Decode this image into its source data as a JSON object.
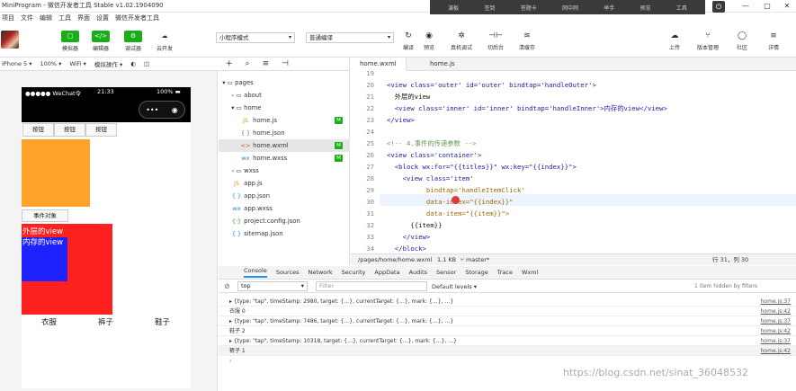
{
  "window": {
    "title": "MiniProgram - 微信开发者工具 Stable v1.02.1904090",
    "controls": [
      "—",
      "□",
      "✕"
    ]
  },
  "float_bar": [
    "演板",
    "签到",
    "答题卡",
    "网中网",
    "举手",
    "预览",
    "工具"
  ],
  "menu": [
    "项目",
    "文件",
    "编辑",
    "工具",
    "界面",
    "设置",
    "微信开发者工具"
  ],
  "toolbar": {
    "left": [
      {
        "icon": "▢",
        "label": "模拟器"
      },
      {
        "icon": "</>",
        "label": "编辑器"
      },
      {
        "icon": "⚙",
        "label": "调试器"
      },
      {
        "icon": "☁",
        "label": "云开发"
      }
    ],
    "mode_select": "小程序模式",
    "compile_select": "普通编译",
    "mid": [
      {
        "icon": "↻",
        "label": "编译"
      },
      {
        "icon": "◉",
        "label": "预览"
      },
      {
        "icon": "✲",
        "label": "真机调试"
      },
      {
        "icon": "⊣⊢",
        "label": "切后台"
      },
      {
        "icon": "≋",
        "label": "清缓存"
      }
    ],
    "right": [
      {
        "icon": "☁",
        "label": "上传"
      },
      {
        "icon": "⑂",
        "label": "版本管理"
      },
      {
        "icon": "◯",
        "label": "社区"
      },
      {
        "icon": "≡",
        "label": "详情"
      }
    ]
  },
  "sim_bar": [
    "iPhone 5 ▾",
    "100% ▾",
    "WiFi ▾",
    "模拟操作 ▾",
    "◐",
    "◫"
  ],
  "phone": {
    "carrier": "●●●●● WeChat令",
    "time": "21:33",
    "battery": "100% ▬",
    "capsule": [
      "•••",
      "◉"
    ],
    "buttons": [
      "按钮",
      "按钮",
      "按钮"
    ],
    "event_button": "事件对象",
    "outer_text": "外层的view",
    "inner_text": "内存的view",
    "items": [
      "衣服",
      "裤子",
      "鞋子"
    ]
  },
  "tree": {
    "head": [
      "+",
      "⌕",
      "≡",
      "⊣"
    ],
    "nodes": [
      {
        "icon": "▾ ▭",
        "label": "pages",
        "badge": ""
      },
      {
        "icon": "› ▭",
        "label": "about",
        "badge": ""
      },
      {
        "icon": "▾ ▭",
        "label": "home",
        "badge": ""
      },
      {
        "icon": "JS",
        "label": "home.js",
        "badge": "M"
      },
      {
        "icon": "{ }",
        "label": "home.json",
        "badge": ""
      },
      {
        "icon": "<>",
        "label": "home.wxml",
        "badge": "M"
      },
      {
        "icon": "wx",
        "label": "home.wxss",
        "badge": "M"
      },
      {
        "icon": "› ▭",
        "label": "wxss",
        "badge": ""
      },
      {
        "icon": "JS",
        "label": "app.js",
        "badge": ""
      },
      {
        "icon": "{ }",
        "label": "app.json",
        "badge": ""
      },
      {
        "icon": "wx",
        "label": "app.wxss",
        "badge": ""
      },
      {
        "icon": "{·}",
        "label": "project.config.json",
        "badge": ""
      },
      {
        "icon": "{ }",
        "label": "sitemap.json",
        "badge": ""
      }
    ]
  },
  "editor": {
    "tabs": [
      "home.wxml",
      "home.js"
    ],
    "line_numbers": [
      "19",
      "20",
      "21",
      "22",
      "23",
      "24",
      "25",
      "26",
      "27",
      "28",
      "29",
      "30",
      "31",
      "32",
      "33",
      "34"
    ],
    "lines": [
      "",
      "<view class='outer' id='outer' bindtap='handleOuter'>",
      "  外层的view",
      "  <view class='inner' id='inner' bindtap='handleInner'>内存的view</view>",
      "</view>",
      "",
      "<!-- 4.事件的传递参数 -->",
      "<view class='container'>",
      "  <block wx:for=\"{{titles}}\" wx:key=\"{{index}}\">",
      "    <view class='item'",
      "          bindtap='handleItemClick'",
      "          data-index=\"{{index}}\"",
      "          data-item=\"{{item}}\">",
      "      {{item}}",
      "    </view>",
      "  </block>"
    ],
    "status_path": "/pages/home/home.wxml",
    "status_size": "1.1 KB",
    "status_branch": "⑂ master*",
    "status_pos": "行 31，列 30"
  },
  "devtools": {
    "tabs": [
      "Console",
      "Sources",
      "Network",
      "Security",
      "AppData",
      "Audits",
      "Sensor",
      "Storage",
      "Trace",
      "Wxml"
    ],
    "context": "top",
    "filter_placeholder": "Filter",
    "levels": "Default levels ▾",
    "hidden": "1 item hidden by filters",
    "logs": [
      {
        "text": "▸ {type: \"tap\", timeStamp: 2980, target: {…}, currentTarget: {…}, mark: {…}, …}",
        "src": "home.js:37"
      },
      {
        "text": "衣服 0",
        "src": "home.js:42"
      },
      {
        "text": "▸ {type: \"tap\", timeStamp: 7486, target: {…}, currentTarget: {…}, mark: {…}, …}",
        "src": "home.js:37"
      },
      {
        "text": "鞋子 2",
        "src": "home.js:42"
      },
      {
        "text": "▸ {type: \"tap\", timeStamp: 10318, target: {…}, currentTarget: {…}, mark: {…}, …}",
        "src": "home.js:37"
      },
      {
        "text": "裤子 1",
        "src": "home.js:42"
      },
      {
        "text": "›",
        "src": ""
      }
    ]
  },
  "watermark": "https://blog.csdn.net/sinat_36048532",
  "colors": {
    "accent": "#1aad19",
    "orange": "#ffa229",
    "red": "#ff2020",
    "blue": "#1e22ff"
  }
}
